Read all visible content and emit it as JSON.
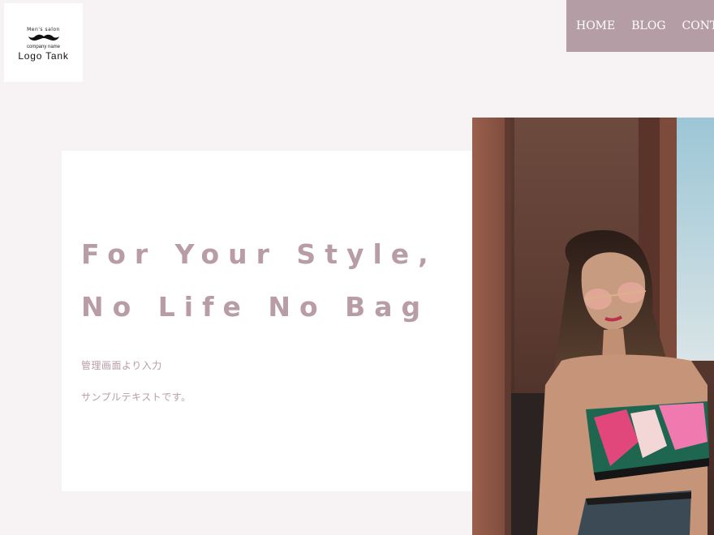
{
  "logo": {
    "arc_text": "Men's salon",
    "company": "company name",
    "name": "Logo Tank"
  },
  "nav": {
    "items": [
      "HOME",
      "BLOG",
      "CONTACT"
    ]
  },
  "hero": {
    "headline_line1": "For Your Style,",
    "headline_line2": "No Life No Bag",
    "text_line1": "管理画面より入力",
    "text_line2": "サンプルテキストです。"
  },
  "colors": {
    "background": "#f7f2f3",
    "nav_background": "#b59da6",
    "accent_text": "#b89ca6"
  }
}
